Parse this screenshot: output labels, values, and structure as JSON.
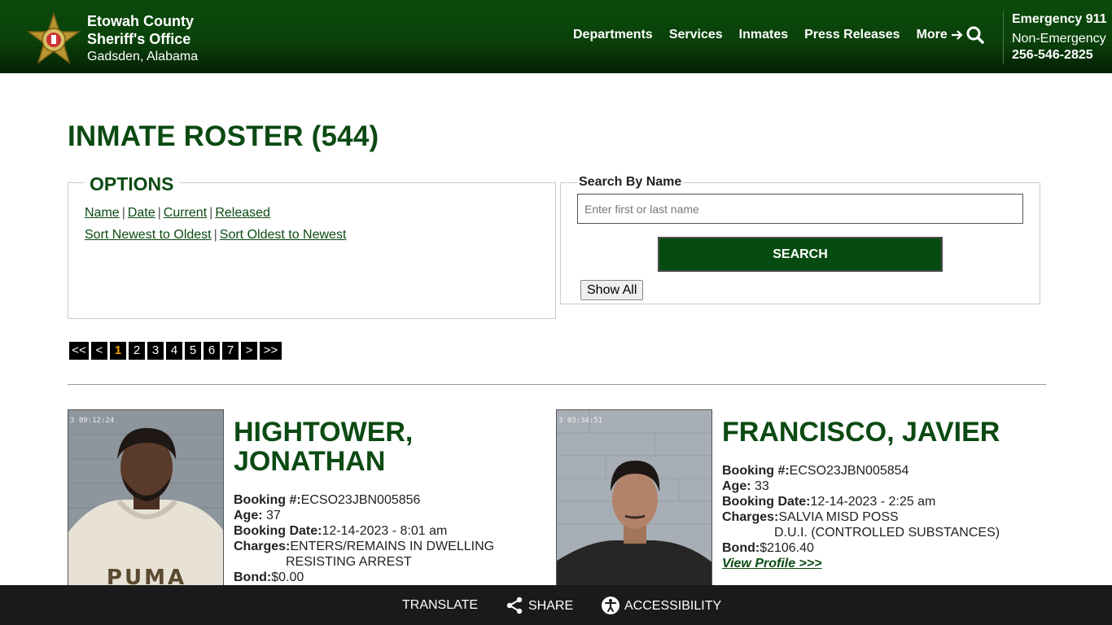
{
  "header": {
    "agency_line1": "Etowah County",
    "agency_line2": "Sheriff's Office",
    "location": "Gadsden, Alabama",
    "nav": [
      "Departments",
      "Services",
      "Inmates",
      "Press Releases"
    ],
    "more_label": "More",
    "emergency_label": "Emergency 911",
    "non_emergency_label": "Non-Emergency",
    "non_emergency_phone": "256-546-2825"
  },
  "main": {
    "title": "INMATE ROSTER (544)",
    "options": {
      "legend": "OPTIONS",
      "sort_links": [
        "Name",
        "Date",
        "Current",
        "Released"
      ],
      "order_links": [
        "Sort Newest to Oldest",
        "Sort Oldest to Newest"
      ]
    },
    "search": {
      "label": "Search By Name",
      "placeholder": "Enter first or last name",
      "value": "",
      "button": "SEARCH",
      "show_all": "Show All"
    },
    "pager": {
      "first": "<<",
      "prev": "<",
      "pages": [
        "1",
        "2",
        "3",
        "4",
        "5",
        "6",
        "7"
      ],
      "current": "1",
      "next": ">",
      "last": ">>"
    }
  },
  "labels": {
    "booking": "Booking #:",
    "age": "Age:",
    "booking_date": "Booking Date:",
    "charges": "Charges:",
    "bond": "Bond:",
    "view_profile": "View Profile >>>"
  },
  "inmates": [
    {
      "name_line1": "HIGHTOWER,",
      "name_line2": "JONATHAN",
      "booking": "ECSO23JBN005856",
      "age": "37",
      "booking_date": "12-14-2023 - 8:01 am",
      "charges": [
        "ENTERS/REMAINS IN DWELLING",
        "RESISTING ARREST"
      ],
      "bond": "$0.00",
      "timestamp": "3  09:12:24",
      "shirt_text": "PUMA"
    },
    {
      "name_line1": "FRANCISCO, JAVIER",
      "booking": "ECSO23JBN005854",
      "age": "33",
      "booking_date": "12-14-2023 - 2:25 am",
      "charges": [
        "SALVIA MISD POSS",
        "D.U.I. (CONTROLLED SUBSTANCES)"
      ],
      "bond": "$2106.40",
      "timestamp": "3  03:34:51"
    }
  ],
  "footer": {
    "translate": "TRANSLATE",
    "share": "SHARE",
    "accessibility": "ACCESSIBILITY"
  },
  "colors": {
    "brand_green": "#0b4a12",
    "header_dark": "#032003",
    "pager_active": "#f0a500",
    "footer_bg": "#1a1a1a"
  }
}
